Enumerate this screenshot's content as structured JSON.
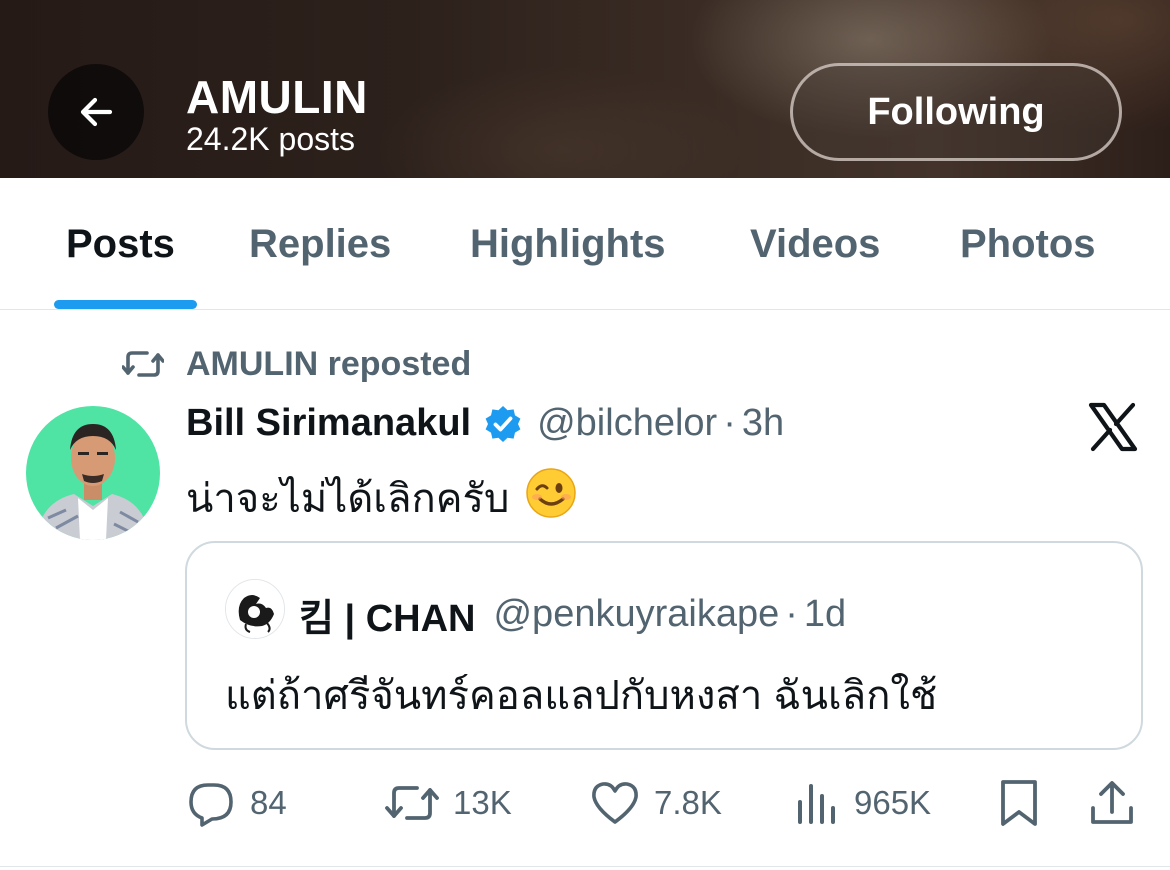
{
  "header": {
    "title": "AMULIN",
    "posts_count": "24.2K posts",
    "following_label": "Following"
  },
  "tabs": [
    {
      "label": "Posts",
      "active": true
    },
    {
      "label": "Replies",
      "active": false
    },
    {
      "label": "Highlights",
      "active": false
    },
    {
      "label": "Videos",
      "active": false
    },
    {
      "label": "Photos",
      "active": false
    }
  ],
  "post": {
    "repost_label": "AMULIN reposted",
    "author_name": "Bill Sirimanakul",
    "author_handle": "@bilchelor",
    "time": "3h",
    "text": "น่าจะไม่ได้เลิกครับ",
    "emoji": "😉",
    "quote": {
      "name": "킴 | CHAN",
      "handle": "@penkuyraikape",
      "time": "1d",
      "text": "แต่ถ้าศรีจันทร์คอลแลปกับหงสา ฉันเลิกใช้"
    },
    "actions": {
      "replies": "84",
      "reposts": "13K",
      "likes": "7.8K",
      "views": "965K"
    }
  },
  "colors": {
    "accent": "#1d9bf0",
    "secondary_text": "#536471",
    "primary_text": "#0f1419",
    "verified": "#1d9bf0",
    "avatar_bg": "#4fe3a4"
  }
}
